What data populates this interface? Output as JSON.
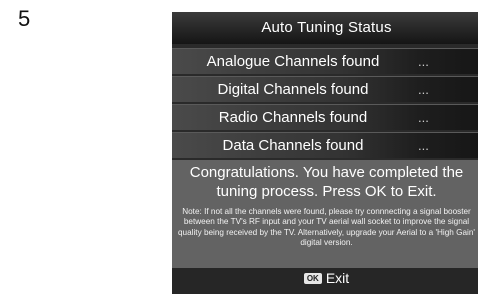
{
  "step_number": "5",
  "screen": {
    "title": "Auto Tuning Status",
    "channels": [
      {
        "label": "Analogue  Channels found",
        "status": "..."
      },
      {
        "label": "Digital Channels found",
        "status": "..."
      },
      {
        "label": "Radio Channels found",
        "status": "..."
      },
      {
        "label": "Data Channels found",
        "status": "..."
      }
    ],
    "congratulations": "Congratulations. You have completed the tuning process. Press OK to Exit.",
    "note": "Note: If not all the channels were found, please try connnecting a signal booster between the TV's RF input and your TV aerial wall socket to improve the signal quality being received by the TV. Alternatively, upgrade your Aerial to a 'High Gain' digital version.",
    "exit": {
      "key_label": "OK",
      "label": "Exit"
    }
  }
}
